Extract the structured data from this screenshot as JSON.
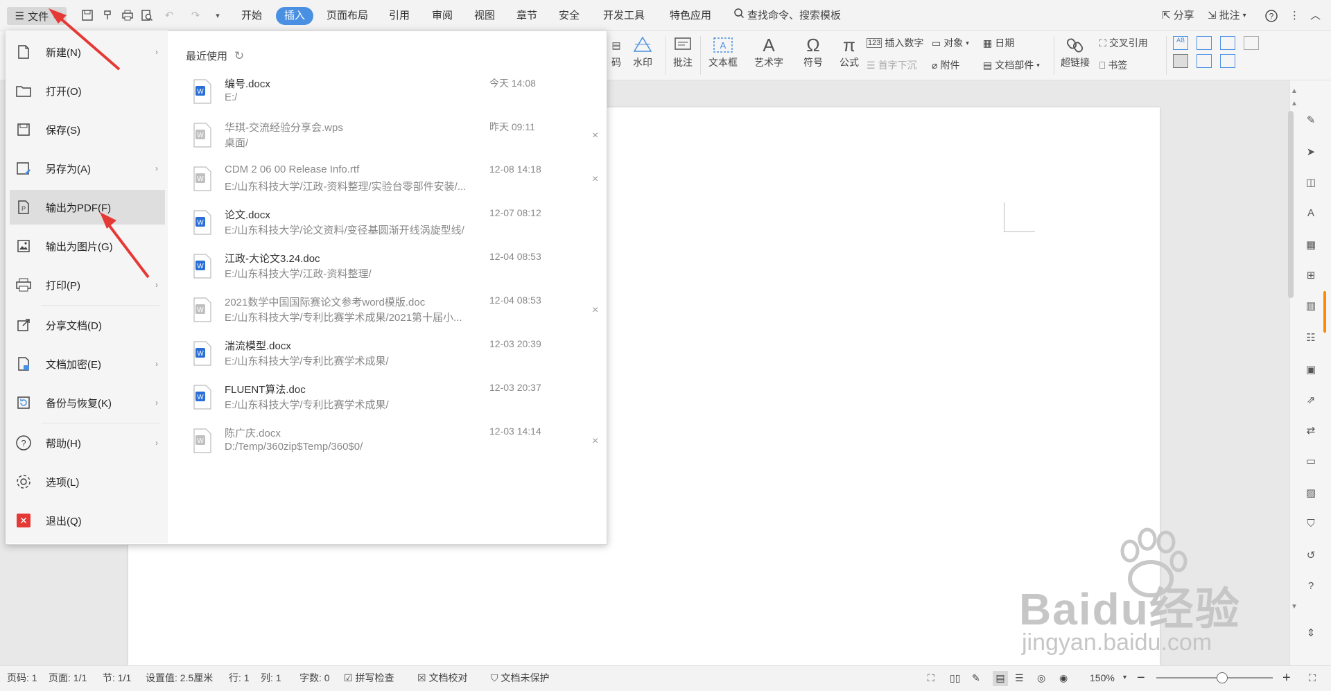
{
  "menubar": {
    "file_label": "文件",
    "tabs": [
      {
        "label": "开始"
      },
      {
        "label": "插入"
      },
      {
        "label": "页面布局"
      },
      {
        "label": "引用"
      },
      {
        "label": "审阅"
      },
      {
        "label": "视图"
      },
      {
        "label": "章节"
      },
      {
        "label": "安全"
      },
      {
        "label": "开发工具"
      },
      {
        "label": "特色应用"
      }
    ],
    "active_tab": "插入",
    "search_placeholder": "查找命令、搜索模板",
    "share_label": "分享",
    "comment_label": "批注"
  },
  "ribbon": {
    "items": {
      "code": "码",
      "watermark": "水印",
      "comment": "批注",
      "textbox": "文本框",
      "wordart": "艺术字",
      "symbol": "符号",
      "formula": "公式",
      "insert_number": "插入数字",
      "object": "对象",
      "date": "日期",
      "drop_cap": "首字下沉",
      "attachment": "附件",
      "doc_parts": "文档部件",
      "hyperlink": "超链接",
      "cross_ref": "交叉引用",
      "bookmark": "书签"
    }
  },
  "file_menu": {
    "items": [
      {
        "label": "新建(N)",
        "has_sub": true
      },
      {
        "label": "打开(O)",
        "has_sub": false
      },
      {
        "label": "保存(S)",
        "has_sub": false
      },
      {
        "label": "另存为(A)",
        "has_sub": true
      },
      {
        "label": "输出为PDF(F)",
        "has_sub": false,
        "selected": true
      },
      {
        "label": "输出为图片(G)",
        "has_sub": false
      },
      {
        "label": "打印(P)",
        "has_sub": true
      },
      {
        "label": "分享文档(D)",
        "has_sub": false
      },
      {
        "label": "文档加密(E)",
        "has_sub": true
      },
      {
        "label": "备份与恢复(K)",
        "has_sub": true
      },
      {
        "label": "帮助(H)",
        "has_sub": true
      },
      {
        "label": "选项(L)",
        "has_sub": false
      },
      {
        "label": "退出(Q)",
        "has_sub": false
      }
    ],
    "recent_title": "最近使用",
    "recent": [
      {
        "name": "编号.docx",
        "path": "E:/",
        "time": "今天 14:08",
        "closable": false,
        "icon": "word-doc-icon"
      },
      {
        "name": "华琪-交流经验分享会.wps",
        "path": "桌面/",
        "time": "昨天 09:11",
        "closable": true,
        "icon": "wps-file-icon"
      },
      {
        "name": "CDM 2 06 00 Release Info.rtf",
        "path": "E:/山东科技大学/江政-资料整理/实验台零部件安装/...",
        "time": "12-08 14:18",
        "closable": true,
        "icon": "rtf-file-icon"
      },
      {
        "name": "论文.docx",
        "path": "E:/山东科技大学/论文资料/变径基圆渐开线涡旋型线/",
        "time": "12-07 08:12",
        "closable": false,
        "icon": "word-doc-icon"
      },
      {
        "name": "江政-大论文3.24.doc",
        "path": "E:/山东科技大学/江政-资料整理/",
        "time": "12-04 08:53",
        "closable": false,
        "icon": "word-doc-icon"
      },
      {
        "name": "2021数学中国国际赛论文参考word模版.doc",
        "path": "E:/山东科技大学/专利比赛学术成果/2021第十届小...",
        "time": "12-04 08:53",
        "closable": true,
        "icon": "doc-file-gray-icon"
      },
      {
        "name": "湍流模型.docx",
        "path": "E:/山东科技大学/专利比赛学术成果/",
        "time": "12-03 20:39",
        "closable": false,
        "icon": "word-doc-icon"
      },
      {
        "name": "FLUENT算法.doc",
        "path": "E:/山东科技大学/专利比赛学术成果/",
        "time": "12-03 20:37",
        "closable": false,
        "icon": "word-doc-icon"
      },
      {
        "name": "陈广庆.docx",
        "path": "D:/Temp/360zip$Temp/360$0/",
        "time": "12-03 14:14",
        "closable": true,
        "icon": "doc-file-gray-icon"
      }
    ]
  },
  "statusbar": {
    "page_no": "页码: 1",
    "pages": "页面: 1/1",
    "section": "节: 1/1",
    "setting": "设置值: 2.5厘米",
    "row": "行: 1",
    "col": "列: 1",
    "words": "字数: 0",
    "spellcheck": "拼写检查",
    "proofread": "文档校对",
    "protect": "文档未保护",
    "zoom": "150%"
  },
  "watermark": {
    "brand": "Baidu经验",
    "url": "jingyan.baidu.com"
  },
  "colors": {
    "accent": "#4a90e2",
    "arrow": "#e53935",
    "exit_icon": "#e53935"
  }
}
